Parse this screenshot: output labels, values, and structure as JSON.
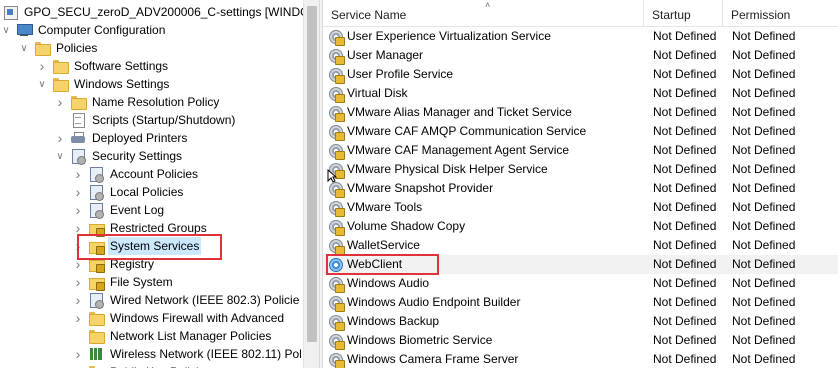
{
  "tree": {
    "items": [
      {
        "label": "GPO_SECU_zeroD_ADV200006_C-settings [WINDOW",
        "icon": "gpo-icon",
        "expander": ""
      },
      {
        "label": "Computer Configuration",
        "icon": "computer-icon",
        "expander": "expanded"
      },
      {
        "label": "Policies",
        "icon": "folder-icon",
        "expander": "expanded"
      },
      {
        "label": "Software Settings",
        "icon": "folder-icon",
        "expander": "collapsed"
      },
      {
        "label": "Windows Settings",
        "icon": "folder-icon",
        "expander": "expanded"
      },
      {
        "label": "Name Resolution Policy",
        "icon": "folder-icon",
        "expander": "collapsed"
      },
      {
        "label": "Scripts (Startup/Shutdown)",
        "icon": "document-icon",
        "expander": ""
      },
      {
        "label": "Deployed Printers",
        "icon": "printer-icon",
        "expander": "collapsed"
      },
      {
        "label": "Security Settings",
        "icon": "policy-icon",
        "expander": "expanded"
      },
      {
        "label": "Account Policies",
        "icon": "policy-icon",
        "expander": "collapsed"
      },
      {
        "label": "Local Policies",
        "icon": "policy-icon",
        "expander": "collapsed"
      },
      {
        "label": "Event Log",
        "icon": "policy-icon",
        "expander": "collapsed"
      },
      {
        "label": "Restricted Groups",
        "icon": "lock-folder-icon",
        "expander": "collapsed"
      },
      {
        "label": "System Services",
        "icon": "lock-folder-icon",
        "expander": "collapsed"
      },
      {
        "label": "Registry",
        "icon": "lock-folder-icon",
        "expander": "collapsed"
      },
      {
        "label": "File System",
        "icon": "lock-folder-icon",
        "expander": "collapsed"
      },
      {
        "label": "Wired Network (IEEE 802.3) Policie",
        "icon": "policy-icon",
        "expander": "collapsed"
      },
      {
        "label": "Windows Firewall with Advanced",
        "icon": "folder-icon",
        "expander": "collapsed"
      },
      {
        "label": "Network List Manager Policies",
        "icon": "folder-icon",
        "expander": ""
      },
      {
        "label": "Wireless Network (IEEE 802.11) Pol",
        "icon": "bars-icon",
        "expander": "collapsed"
      },
      {
        "label": "Public Key Policies",
        "icon": "folder-icon",
        "expander": "collapsed"
      }
    ],
    "selected_label": "System Services"
  },
  "list": {
    "columns": {
      "name": "Service Name",
      "startup": "Startup",
      "permission": "Permission"
    },
    "rows": [
      {
        "name": "User Experience Virtualization Service",
        "startup": "Not Defined",
        "permission": "Not Defined"
      },
      {
        "name": "User Manager",
        "startup": "Not Defined",
        "permission": "Not Defined"
      },
      {
        "name": "User Profile Service",
        "startup": "Not Defined",
        "permission": "Not Defined"
      },
      {
        "name": "Virtual Disk",
        "startup": "Not Defined",
        "permission": "Not Defined"
      },
      {
        "name": "VMware Alias Manager and Ticket Service",
        "startup": "Not Defined",
        "permission": "Not Defined"
      },
      {
        "name": "VMware CAF AMQP Communication Service",
        "startup": "Not Defined",
        "permission": "Not Defined"
      },
      {
        "name": "VMware CAF Management Agent Service",
        "startup": "Not Defined",
        "permission": "Not Defined"
      },
      {
        "name": "VMware Physical Disk Helper Service",
        "startup": "Not Defined",
        "permission": "Not Defined"
      },
      {
        "name": "VMware Snapshot Provider",
        "startup": "Not Defined",
        "permission": "Not Defined"
      },
      {
        "name": "VMware Tools",
        "startup": "Not Defined",
        "permission": "Not Defined"
      },
      {
        "name": "Volume Shadow Copy",
        "startup": "Not Defined",
        "permission": "Not Defined"
      },
      {
        "name": "WalletService",
        "startup": "Not Defined",
        "permission": "Not Defined"
      },
      {
        "name": "WebClient",
        "startup": "Not Defined",
        "permission": "Not Defined"
      },
      {
        "name": "Windows Audio",
        "startup": "Not Defined",
        "permission": "Not Defined"
      },
      {
        "name": "Windows Audio Endpoint Builder",
        "startup": "Not Defined",
        "permission": "Not Defined"
      },
      {
        "name": "Windows Backup",
        "startup": "Not Defined",
        "permission": "Not Defined"
      },
      {
        "name": "Windows Biometric Service",
        "startup": "Not Defined",
        "permission": "Not Defined"
      },
      {
        "name": "Windows Camera Frame Server",
        "startup": "Not Defined",
        "permission": "Not Defined"
      }
    ],
    "highlighted_name": "WebClient"
  },
  "colors": {
    "annotation": "#e0323a",
    "selection": "#cce8ff"
  }
}
